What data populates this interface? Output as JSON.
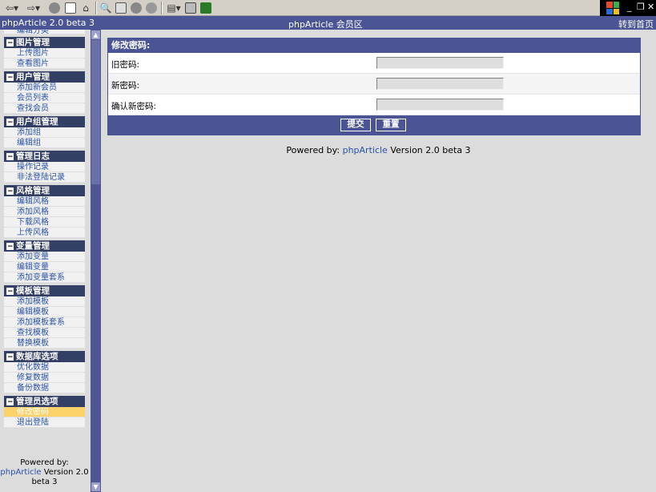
{
  "window": {
    "title_left": "phpArticle 2.0 beta 3",
    "title_center": "phpArticle 会员区",
    "home_link": "转到首页"
  },
  "toolbar": {
    "icons": [
      "back-icon",
      "forward-icon",
      "stop-icon",
      "refresh-icon",
      "home-icon",
      "search-icon",
      "favorites-icon",
      "history-icon",
      "mail-icon",
      "print-icon",
      "messenger-icon"
    ]
  },
  "sidebar": {
    "partial_item": "编辑分类",
    "categories": [
      {
        "title": "图片管理",
        "items": [
          "上传图片",
          "查看图片"
        ]
      },
      {
        "title": "用户管理",
        "items": [
          "添加新会员",
          "会员列表",
          "查找会员"
        ]
      },
      {
        "title": "用户组管理",
        "items": [
          "添加组",
          "编辑组"
        ]
      },
      {
        "title": "管理日志",
        "items": [
          "操作记录",
          "非法登陆记录"
        ]
      },
      {
        "title": "风格管理",
        "items": [
          "编辑风格",
          "添加风格",
          "下载风格",
          "上传风格"
        ]
      },
      {
        "title": "变量管理",
        "items": [
          "添加变量",
          "编辑变量",
          "添加变量套系"
        ]
      },
      {
        "title": "模板管理",
        "items": [
          "添加模板",
          "编辑模板",
          "添加模板套系",
          "查找模板",
          "替换模板"
        ]
      },
      {
        "title": "数据库选项",
        "items": [
          "优化数据",
          "修复数据",
          "备份数据"
        ]
      },
      {
        "title": "管理员选项",
        "items": [
          "修改密码",
          "退出登陆"
        ]
      }
    ],
    "active_item": "修改密码",
    "footer": {
      "powered_by": "Powered by:",
      "link": "phpArticle",
      "version_part1": " Version 2.0",
      "version_part2": "beta 3"
    }
  },
  "form": {
    "title": "修改密码:",
    "fields": [
      {
        "label": "旧密码:",
        "value": ""
      },
      {
        "label": "新密码:",
        "value": ""
      },
      {
        "label": "确认新密码:",
        "value": ""
      }
    ],
    "submit_label": "提交",
    "reset_label": "重置"
  },
  "footer": {
    "powered_by": "Powered by: ",
    "link": "phpArticle",
    "version": " Version 2.0 beta 3"
  },
  "colors": {
    "header_blue": "#4b5596",
    "category_navy": "#333f64",
    "link_blue": "#2a52a6",
    "active_highlight": "#fbd26a"
  }
}
